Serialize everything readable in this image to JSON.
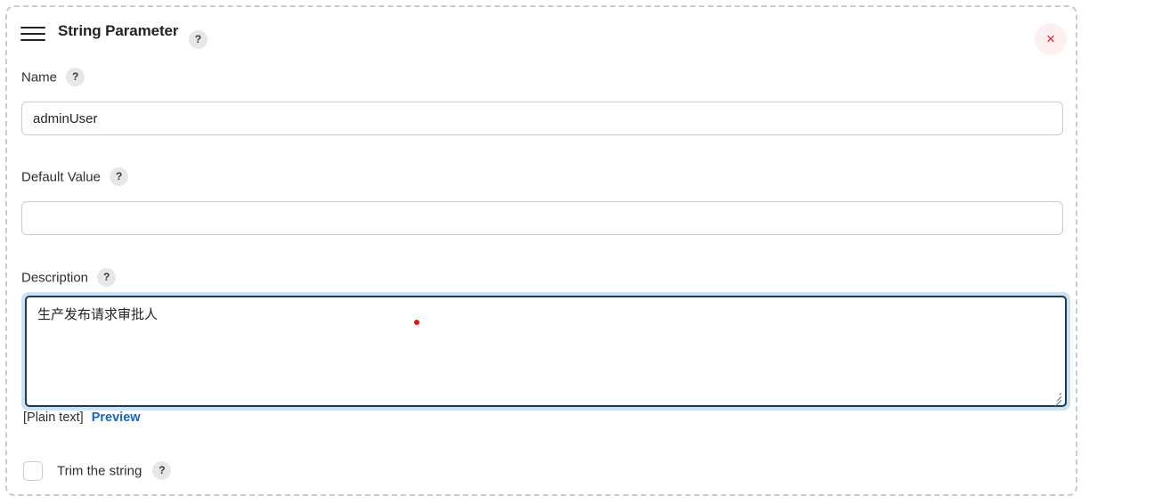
{
  "panel": {
    "title": "String Parameter",
    "menu_icon": "hamburger-menu-icon",
    "help_badge": "?",
    "close_icon": "×"
  },
  "fields": {
    "name": {
      "label": "Name",
      "help_badge": "?",
      "value": "adminUser",
      "placeholder": ""
    },
    "default_value": {
      "label": "Default Value",
      "help_badge": "?",
      "value": "",
      "placeholder": ""
    },
    "description": {
      "label": "Description",
      "help_badge": "?",
      "value": "生产发布请求审批人",
      "placeholder": "",
      "format_note": "[Plain text]",
      "preview_link": "Preview"
    }
  },
  "options": {
    "trim": {
      "label": "Trim the string",
      "help_badge": "?",
      "checked": false
    }
  },
  "colors": {
    "accent_link": "#1964c8",
    "focus_border": "#103e5c",
    "focus_ring": "#cfe0ee",
    "close_fg": "#e01b3c",
    "close_bg": "#fdeef0",
    "caret_dot": "#e8160c",
    "panel_dashed_border": "#c3ccd4",
    "input_border": "#c4ced6"
  }
}
